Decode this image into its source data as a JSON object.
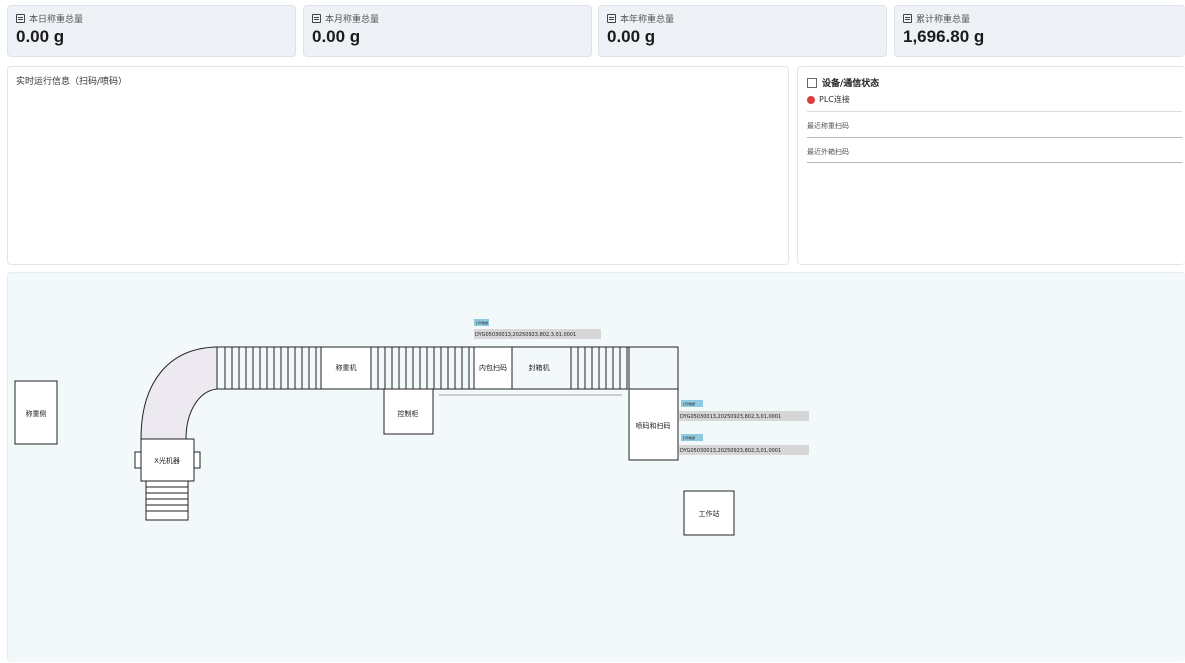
{
  "stats": [
    {
      "label": "本日称重总量",
      "value": "0.00 g",
      "icon": "calendar-icon"
    },
    {
      "label": "本月称重总量",
      "value": "0.00 g",
      "icon": "list-icon"
    },
    {
      "label": "本年称重总量",
      "value": "0.00 g",
      "icon": "document-icon"
    },
    {
      "label": "累计称重总量",
      "value": "1,696.80 g",
      "icon": "clipboard-icon"
    }
  ],
  "info_panel": {
    "title": "实时运行信息（扫码/喷码）"
  },
  "status_panel": {
    "title": "设备/通信状态",
    "plc_label": "PLC连接",
    "plc_color": "#d84040",
    "recent_weigh_scan_label": "最近称重扫码",
    "recent_box_scan_label": "最近外箱扫码"
  },
  "diagram": {
    "weigh_side": "称重侧",
    "xray": "X光机器",
    "weigher": "称重机",
    "control_cabinet": "控制柜",
    "inner_scan": "内包扫码",
    "sealer": "封箱机",
    "spray_scan": "喷码和扫码",
    "workstation": "工作站",
    "tag_label": "打印数据",
    "code_top": "DYG05030013,20250923,802,3,01,0001",
    "code_right_1": "DYG05030013,20250923,802,3,01,0001",
    "code_right_2": "DYG05030013,20250923,802,3,01,0001"
  }
}
